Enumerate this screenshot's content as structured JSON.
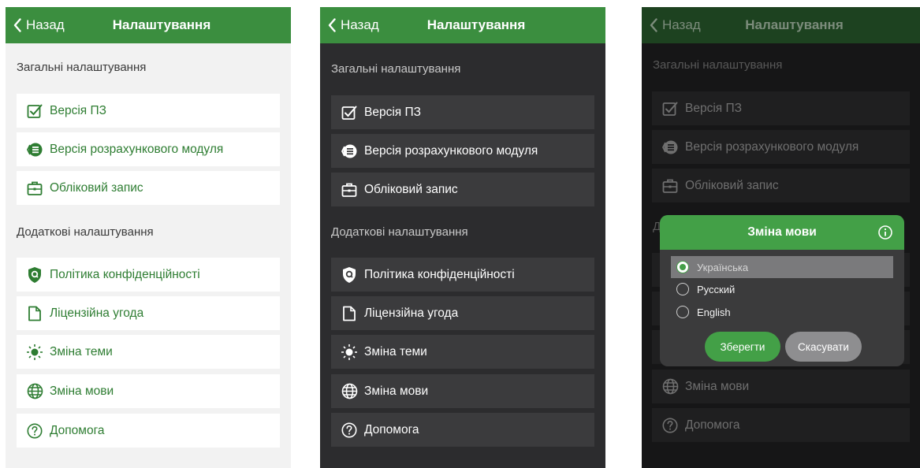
{
  "colors": {
    "accent": "#3b8e3f",
    "light_bg": "#f2f2f2",
    "dark_bg": "#2c2c2e",
    "overlay_bg": "#161617",
    "dialog_header": "#43a047"
  },
  "header": {
    "back_label": "Назад",
    "title": "Налаштування"
  },
  "sections": {
    "general": "Загальні налаштування",
    "additional": "Додаткові налаштування"
  },
  "items": [
    {
      "label": "Версія ПЗ",
      "icon": "checkbox-icon"
    },
    {
      "label": "Версія розрахункового модуля",
      "icon": "module-icon"
    },
    {
      "label": "Обліковий запис",
      "icon": "briefcase-icon"
    },
    {
      "label": "Політика конфіденційності",
      "icon": "shield-icon"
    },
    {
      "label": "Ліцензійна угода",
      "icon": "document-icon"
    },
    {
      "label": "Зміна теми",
      "icon": "sun-icon"
    },
    {
      "label": "Зміна мови",
      "icon": "globe-icon"
    },
    {
      "label": "Допомога",
      "icon": "help-icon"
    }
  ],
  "language_dialog": {
    "title": "Зміна мови",
    "options": [
      "Українська",
      "Русский",
      "English"
    ],
    "selected": "Українська",
    "save_label": "Зберегти",
    "cancel_label": "Скасувати"
  }
}
